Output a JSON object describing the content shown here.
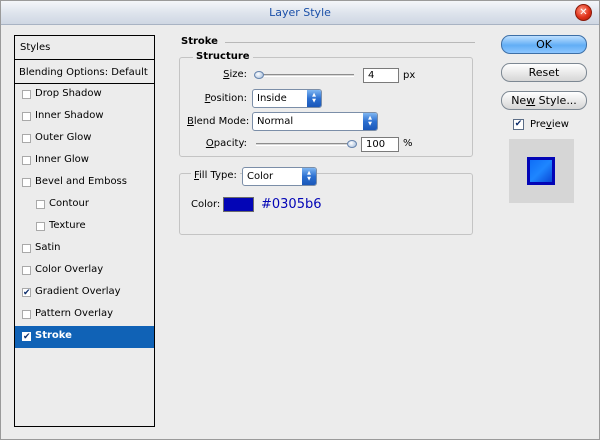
{
  "window": {
    "title": "Layer Style"
  },
  "styles_panel": {
    "header": "Styles",
    "blending_options": "Blending Options: Default",
    "items": [
      {
        "label": "Drop Shadow",
        "checked": false,
        "indent": false,
        "selected": false
      },
      {
        "label": "Inner Shadow",
        "checked": false,
        "indent": false,
        "selected": false
      },
      {
        "label": "Outer Glow",
        "checked": false,
        "indent": false,
        "selected": false
      },
      {
        "label": "Inner Glow",
        "checked": false,
        "indent": false,
        "selected": false
      },
      {
        "label": "Bevel and Emboss",
        "checked": false,
        "indent": false,
        "selected": false
      },
      {
        "label": "Contour",
        "checked": false,
        "indent": true,
        "selected": false
      },
      {
        "label": "Texture",
        "checked": false,
        "indent": true,
        "selected": false
      },
      {
        "label": "Satin",
        "checked": false,
        "indent": false,
        "selected": false
      },
      {
        "label": "Color Overlay",
        "checked": false,
        "indent": false,
        "selected": false
      },
      {
        "label": "Gradient Overlay",
        "checked": true,
        "indent": false,
        "selected": false
      },
      {
        "label": "Pattern Overlay",
        "checked": false,
        "indent": false,
        "selected": false
      },
      {
        "label": "Stroke",
        "checked": true,
        "indent": false,
        "selected": true
      }
    ]
  },
  "stroke": {
    "title": "Stroke",
    "structure_title": "Structure",
    "size": {
      "label_pre": "",
      "label_u": "S",
      "label_post": "ize:",
      "value": "4",
      "unit": "px"
    },
    "position": {
      "label_u": "P",
      "label_post": "osition:",
      "value": "Inside"
    },
    "blend_mode": {
      "label_u": "B",
      "label_post": "lend Mode:",
      "value": "Normal"
    },
    "opacity": {
      "label_u": "O",
      "label_post": "pacity:",
      "value": "100",
      "unit": "%"
    },
    "fill_type": {
      "label_u": "F",
      "label_post": "ill Type:",
      "value": "Color"
    },
    "color": {
      "label": "Color:",
      "hex": "#0305b6",
      "swatch": "#0305b6"
    }
  },
  "buttons": {
    "ok": "OK",
    "reset": "Reset",
    "new_style_pre": "Ne",
    "new_style_u": "w",
    "new_style_post": " Style...",
    "preview_pre": "Pre",
    "preview_u": "v",
    "preview_post": "iew",
    "preview_checked": true
  },
  "colors": {
    "accent": "#1062b6",
    "stroke_color": "#0305b6",
    "title_text": "#1a4fa8"
  },
  "icons": {
    "close": "close-icon",
    "select_arrows": "updown-arrow-icon",
    "slider_knob": "slider-knob"
  }
}
